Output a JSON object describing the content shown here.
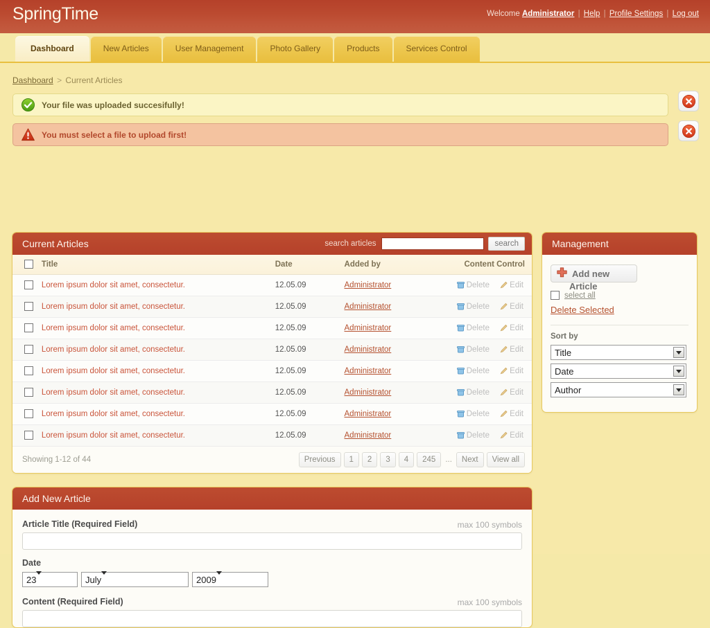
{
  "header": {
    "logo": "SpringTime",
    "welcome": "Welcome",
    "admin": "Administrator",
    "help": "Help",
    "profile_settings": "Profile Settings",
    "logout": "Log out",
    "sep": "|"
  },
  "tabs": [
    {
      "label": "Dashboard",
      "active": true
    },
    {
      "label": "New Articles",
      "active": false
    },
    {
      "label": "User Management",
      "active": false
    },
    {
      "label": "Photo Gallery",
      "active": false
    },
    {
      "label": "Products",
      "active": false
    },
    {
      "label": "Services Control",
      "active": false
    }
  ],
  "breadcrumb": {
    "root": "Dashboard",
    "sep": ">",
    "current": "Current Articles"
  },
  "alerts": [
    {
      "type": "success",
      "icon": "check-circle-icon",
      "text": "Your file was uploaded succesifully!"
    },
    {
      "type": "warning",
      "icon": "warning-triangle-icon",
      "text": "You must select a file to upload first!"
    }
  ],
  "articles_panel": {
    "title": "Current Articles",
    "search_label": "search articles",
    "search_value": "",
    "search_placeholder": "",
    "search_button": "search",
    "columns": [
      "Title",
      "Date",
      "Added by",
      "Content Control"
    ],
    "delete_label": "Delete",
    "edit_label": "Edit",
    "rows": [
      {
        "title": "Lorem ipsum dolor sit amet, consectetur.",
        "date": "12.05.09",
        "added_by": "Administrator"
      },
      {
        "title": "Lorem ipsum dolor sit amet, consectetur.",
        "date": "12.05.09",
        "added_by": "Administrator"
      },
      {
        "title": "Lorem ipsum dolor sit amet, consectetur.",
        "date": "12.05.09",
        "added_by": "Administrator"
      },
      {
        "title": "Lorem ipsum dolor sit amet, consectetur.",
        "date": "12.05.09",
        "added_by": "Administrator"
      },
      {
        "title": "Lorem ipsum dolor sit amet, consectetur.",
        "date": "12.05.09",
        "added_by": "Administrator"
      },
      {
        "title": "Lorem ipsum dolor sit amet, consectetur.",
        "date": "12.05.09",
        "added_by": "Administrator"
      },
      {
        "title": "Lorem ipsum dolor sit amet, consectetur.",
        "date": "12.05.09",
        "added_by": "Administrator"
      },
      {
        "title": "Lorem ipsum dolor sit amet, consectetur.",
        "date": "12.05.09",
        "added_by": "Administrator"
      }
    ],
    "showing": "Showing 1-12 of 44",
    "pager": {
      "previous": "Previous",
      "pages": [
        "1",
        "2",
        "3",
        "4",
        "245"
      ],
      "dots": "...",
      "next": "Next",
      "view_all": "View all"
    }
  },
  "management": {
    "title": "Management",
    "add_new": "Add new",
    "add_new_overflow": "Article",
    "plus_icon": "plus-icon",
    "select_all": "select all",
    "delete_selected": "Delete Selected",
    "sort_by_label": "Sort by",
    "sort_selects": [
      {
        "name": "title",
        "value": "Title"
      },
      {
        "name": "date",
        "value": "Date"
      },
      {
        "name": "author",
        "value": "Author"
      }
    ]
  },
  "add_article_form": {
    "title": "Add New Article",
    "article_title_label": "Article Title",
    "required_note": "(Required Field)",
    "max_symbols": "max 100 symbols",
    "article_title_value": "",
    "date_label": "Date",
    "date": {
      "day": "23",
      "month": "July",
      "year": "2009"
    },
    "content_label": "Content",
    "content_required_note": "(Required Field)",
    "content_max_symbols": "max 100 symbols",
    "content_value": ""
  },
  "colors": {
    "brand_red": "#b5412a",
    "tab_yellow": "#e9bf3f",
    "page_bg": "#f7e9a9",
    "success_bg": "#fbf5c5",
    "warning_bg": "#f4c3a0",
    "link_red": "#b5512f"
  }
}
